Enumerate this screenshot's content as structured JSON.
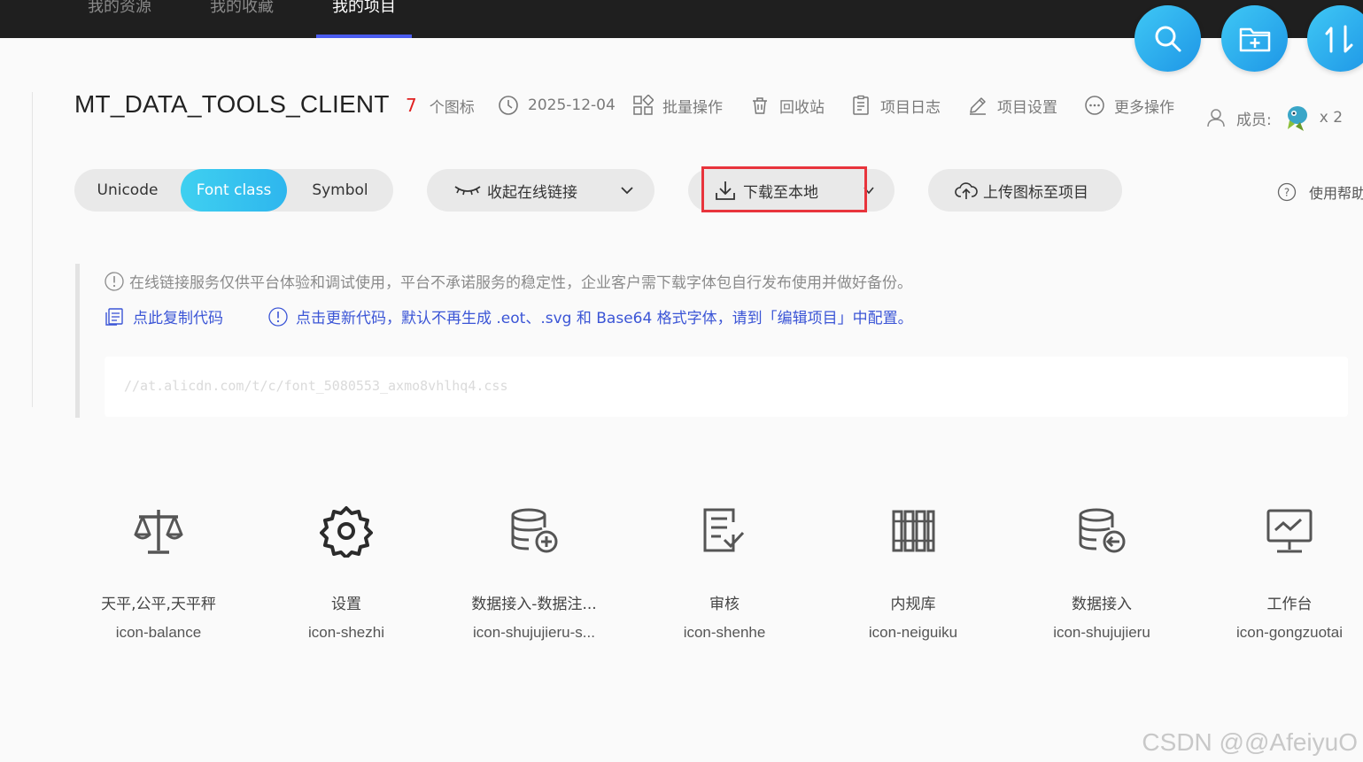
{
  "nav": {
    "tabs": [
      "我的资源",
      "我的收藏",
      "我的项目"
    ],
    "active_tab": "我的项目"
  },
  "project": {
    "title": "MT_DATA_TOOLS_CLIENT",
    "icon_count": "7",
    "icon_count_label": "个图标",
    "date": "2025-12-04",
    "actions": {
      "batch": "批量操作",
      "recycle": "回收站",
      "log": "项目日志",
      "settings": "项目设置",
      "more": "更多操作"
    },
    "members_label": "成员:",
    "members_count": "x 2"
  },
  "toolbar": {
    "formats": [
      "Unicode",
      "Font class",
      "Symbol"
    ],
    "active_format": "Font class",
    "collapse_label": "收起在线链接",
    "download_label": "下载至本地",
    "upload_label": "上传图标至项目",
    "help_label": "使用帮助"
  },
  "notice": {
    "warning": "在线链接服务仅供平台体验和调试使用，平台不承诺服务的稳定性，企业客户需下载字体包自行发布使用并做好备份。",
    "copy_code": "点此复制代码",
    "update_code": "点击更新代码，默认不再生成 .eot、.svg 和 Base64 格式字体，请到「编辑项目」中配置。",
    "code_url": "//at.alicdn.com/t/c/font_5080553_axmo8vhlhq4.css"
  },
  "icons": [
    {
      "name": "天平,公平,天平秤",
      "class": "icon-balance",
      "glyph": "balance-icon"
    },
    {
      "name": "设置",
      "class": "icon-shezhi",
      "glyph": "gear-icon"
    },
    {
      "name": "数据接入-数据注...",
      "class": "icon-shujujieru-s...",
      "glyph": "database-add-icon"
    },
    {
      "name": "审核",
      "class": "icon-shenhe",
      "glyph": "audit-icon"
    },
    {
      "name": "内规库",
      "class": "icon-neiguiku",
      "glyph": "library-icon"
    },
    {
      "name": "数据接入",
      "class": "icon-shujujieru",
      "glyph": "database-in-icon"
    },
    {
      "name": "工作台",
      "class": "icon-gongzuotai",
      "glyph": "monitor-icon"
    }
  ],
  "watermark": "CSDN @@AfeiyuO",
  "colors": {
    "accent": "#2eb6ee",
    "nav_active": "#4a5cf0",
    "highlight": "#e8343c",
    "link": "#3b55d6",
    "count": "#e02020"
  }
}
